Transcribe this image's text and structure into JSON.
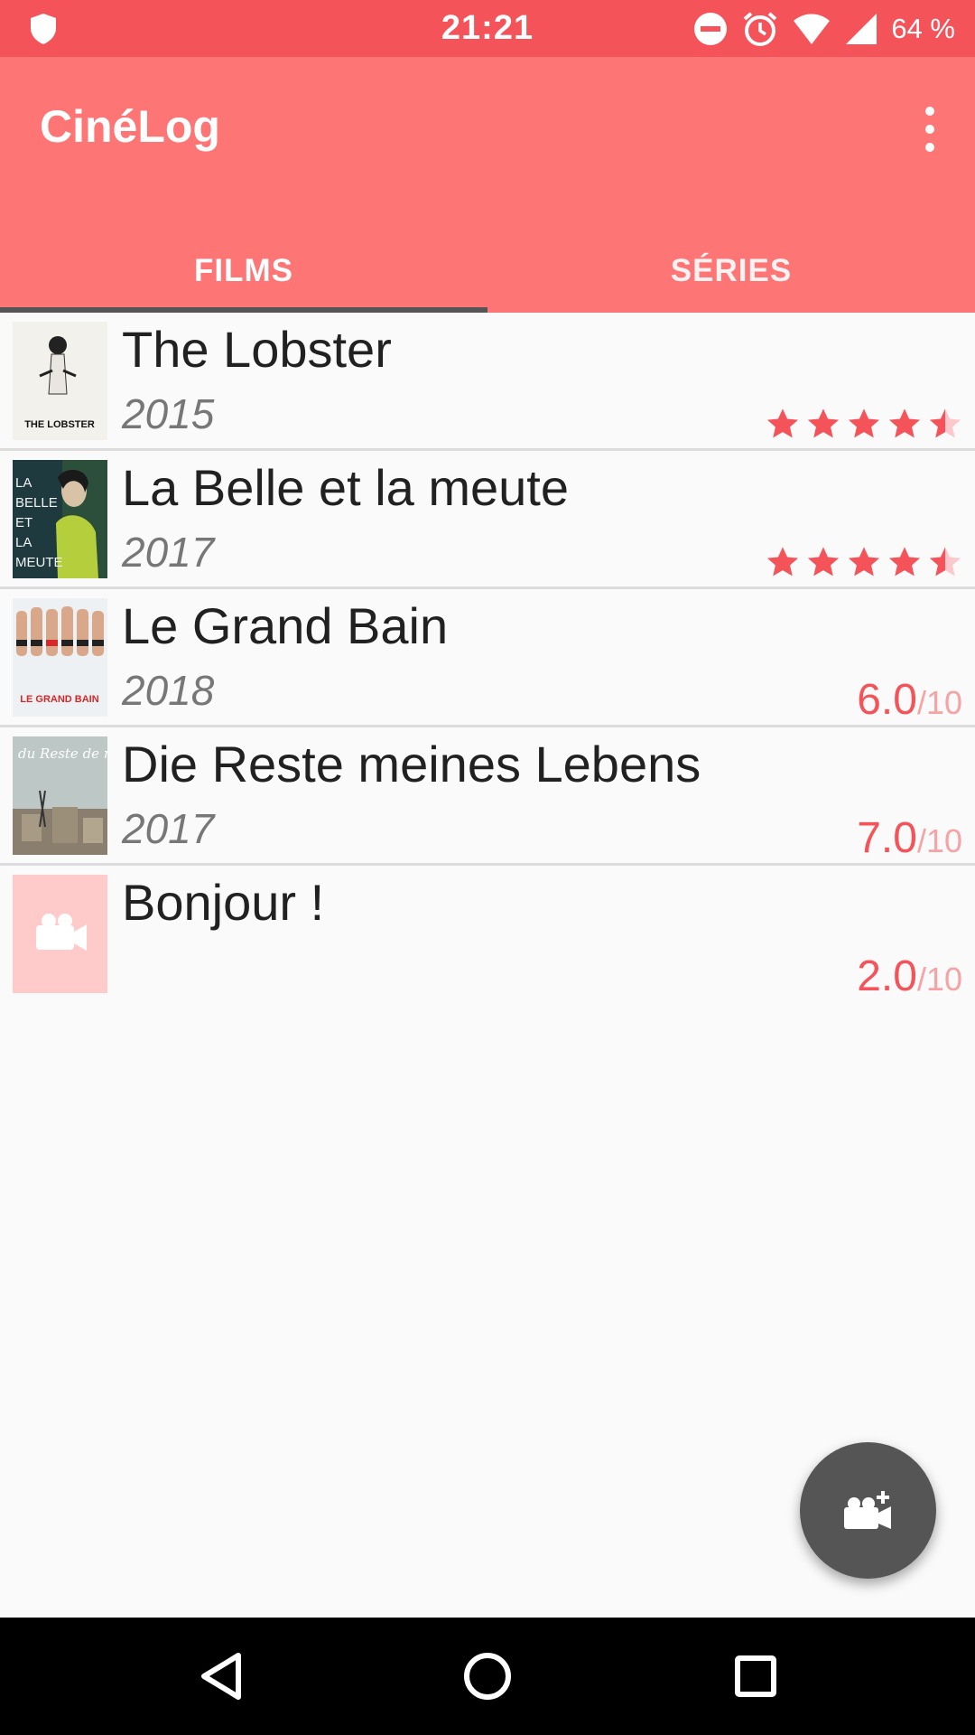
{
  "status_bar": {
    "time": "21:21",
    "battery": "64 %",
    "icons": [
      "shield-icon",
      "do-not-disturb-icon",
      "alarm-icon",
      "wifi-icon",
      "signal-icon"
    ]
  },
  "app_bar": {
    "title": "CinéLog",
    "menu_icon": "more-vert-icon"
  },
  "tabs": [
    {
      "label": "FILMS",
      "active": true
    },
    {
      "label": "SÉRIES",
      "active": false
    }
  ],
  "films": [
    {
      "title": "The Lobster",
      "year": "2015",
      "rating_type": "stars",
      "stars": 4.5,
      "poster_text": "THE LOBSTER"
    },
    {
      "title": "La Belle et la meute",
      "year": "2017",
      "rating_type": "stars",
      "stars": 4.5,
      "poster_text": "LA BELLE ET LA MEUTE"
    },
    {
      "title": "Le Grand Bain",
      "year": "2018",
      "rating_type": "score",
      "score": "6.0",
      "max": "/10",
      "poster_text": "LE GRAND BAIN"
    },
    {
      "title": "Die Reste meines Lebens",
      "year": "2017",
      "rating_type": "score",
      "score": "7.0",
      "max": "/10",
      "poster_text": "du Reste de mon Libens"
    },
    {
      "title": "Bonjour !",
      "year": "",
      "rating_type": "score",
      "score": "2.0",
      "max": "/10",
      "poster_text": ""
    }
  ],
  "fab": {
    "icon": "add-movie-icon"
  },
  "colors": {
    "status_bar": "#f5535a",
    "app_bar": "#fe7575",
    "accent": "#f5535a",
    "fab": "#555555"
  }
}
